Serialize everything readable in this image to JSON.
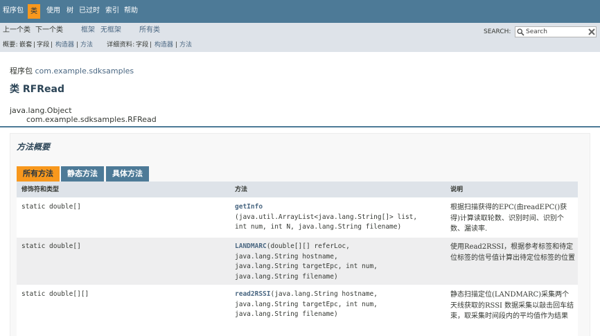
{
  "topnav": {
    "items": [
      {
        "label": "程序包"
      },
      {
        "label": "类"
      },
      {
        "label": "使用"
      },
      {
        "label": "树"
      },
      {
        "label": "已过时"
      },
      {
        "label": "索引"
      },
      {
        "label": "帮助"
      }
    ]
  },
  "subnav": {
    "prev_class": "上一个类",
    "next_class": "下一个类",
    "frames": "框架",
    "no_frames": "无框架",
    "all_classes": "所有类",
    "summary_label": "概要:",
    "summary_nested": "嵌套",
    "sep": "|",
    "summary_field": "字段",
    "summary_constructor": "构造器",
    "summary_method": "方法",
    "detail_label": "详细资料:",
    "detail_field": "字段",
    "detail_constructor": "构造器",
    "detail_method": "方法"
  },
  "search": {
    "label": "SEARCH:",
    "placeholder": "Search"
  },
  "header": {
    "package_prefix": "程序包",
    "package_name": "com.example.sdksamples",
    "class_title": "类 RFRead",
    "inheritance_root": "java.lang.Object",
    "inheritance_child": "com.example.sdksamples.RFRead"
  },
  "method_summary": {
    "title": "方法概要",
    "tabs": [
      {
        "label": "所有方法",
        "active": true
      },
      {
        "label": "静态方法",
        "active": false
      },
      {
        "label": "具体方法",
        "active": false
      }
    ],
    "columns": [
      "修饰符和类型",
      "方法",
      "说明"
    ],
    "rows": [
      {
        "modifier": "static double[]",
        "method_name": "getInfo",
        "params": "\n(java.util.ArrayList<java.lang.String[]> list,\nint num, int N, java.lang.String filename)",
        "description": "根据扫描获得的EPC(由readEPC()获得)计算读取轮数、识别时间、识别个数、漏读率."
      },
      {
        "modifier": "static double[]",
        "method_name": "LANDMARC",
        "params": "(double[][] referLoc,\njava.lang.String hostname,\njava.lang.String targetEpc, int num,\njava.lang.String filename)",
        "description": "使用Read2RSSI，根据参考标签和待定位标签的信号值计算出待定位标签的位置"
      },
      {
        "modifier": "static double[][]",
        "method_name": "read2RSSI",
        "params": "(java.lang.String hostname,\njava.lang.String targetEpc, int num,\njava.lang.String filename)",
        "description": "静态扫描定位(LANDMARC)采集两个天线获取的RSSI 数据采集以敲击回车结束，取采集时间段内的平均值作为结果"
      }
    ]
  },
  "colors": {
    "nav_bg": "#4d7a97",
    "subnav_bg": "#dee3e9",
    "accent": "#f8981d",
    "link": "#4a6782"
  }
}
